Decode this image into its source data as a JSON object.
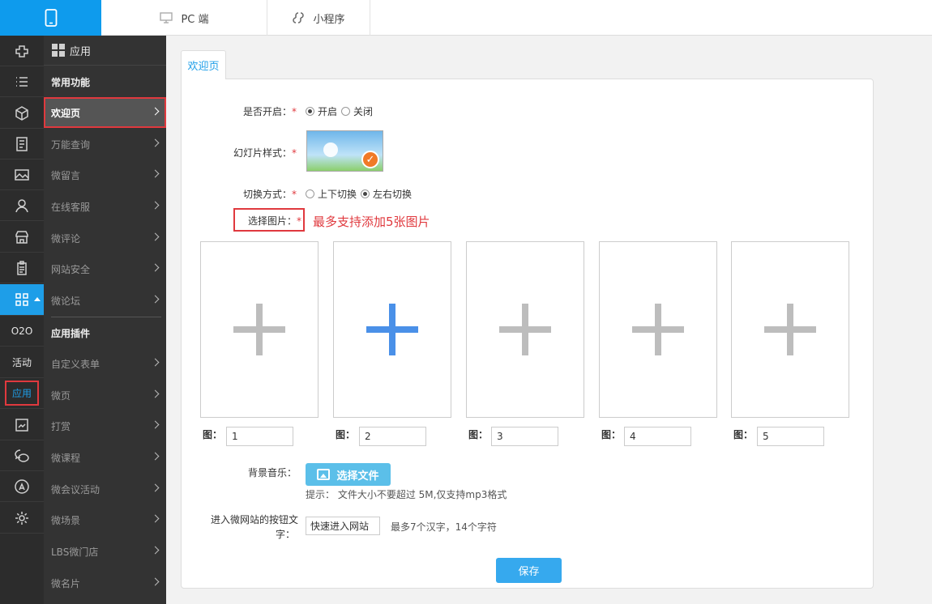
{
  "top_tabs": {
    "mobile_icon": "mobile-icon",
    "pc": "PC 端",
    "mini": "小程序"
  },
  "rail": {
    "text_items": [
      "O2O",
      "活动",
      "应用"
    ]
  },
  "menu": {
    "header": "应用",
    "section1": "常用功能",
    "items1": [
      "欢迎页",
      "万能查询",
      "微留言",
      "在线客服",
      "微评论",
      "网站安全",
      "微论坛"
    ],
    "section2": "应用插件",
    "items2": [
      "自定义表单",
      "微页",
      "打赏",
      "微课程",
      "微会议活动",
      "微场景",
      "LBS微门店",
      "微名片"
    ]
  },
  "page_tab": "欢迎页",
  "form": {
    "enable_label": "是否开启：",
    "enable_on": "开启",
    "enable_off": "关闭",
    "slide_label": "幻灯片样式：",
    "switch_label": "切换方式：",
    "switch_v": "上下切换",
    "switch_h": "左右切换",
    "select_label": "选择图片：",
    "select_hint": "最多支持添加5张图片",
    "req": "*",
    "images": [
      {
        "cap": "图：",
        "value": "1"
      },
      {
        "cap": "图：",
        "value": "2"
      },
      {
        "cap": "图：",
        "value": "3"
      },
      {
        "cap": "图：",
        "value": "4"
      },
      {
        "cap": "图：",
        "value": "5"
      }
    ],
    "music_label": "背景音乐：",
    "upload_button": "选择文件",
    "upload_hint": "提示： 文件大小不要超过 5M,仅支持mp3格式",
    "enter_label_1": "进入微网站的按钮文",
    "enter_label_2": "字：",
    "enter_value": "快速进入网站",
    "enter_hint": "最多7个汉字，14个字符",
    "save": "保存"
  },
  "colors": {
    "accent": "#1e9ee8",
    "highlight": "#e0393e",
    "plus_active": "#4a90e8"
  }
}
